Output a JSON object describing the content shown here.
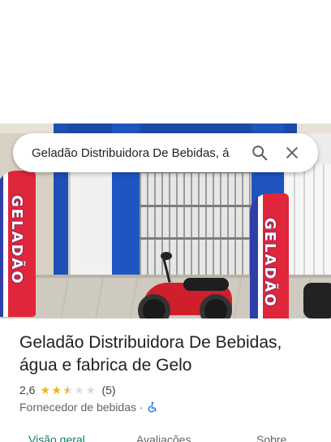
{
  "search": {
    "query": "Geladão Distribuidora De Bebidas, á",
    "search_icon": "search-icon",
    "close_icon": "close-icon"
  },
  "photo": {
    "banner_text": "GELADÃO"
  },
  "place": {
    "name": "Geladão Distribuidora De Bebidas, água e fabrica de Gelo",
    "rating_value": "2,6",
    "rating_stars": 2.6,
    "review_count": "(5)",
    "category": "Fornecedor de bebidas",
    "separator": "·",
    "accessibility_icon": "wheelchair-accessible-icon"
  },
  "tabs": [
    {
      "label": "Visão geral",
      "active": true
    },
    {
      "label": "Avaliações",
      "active": false
    },
    {
      "label": "Sobre",
      "active": false
    }
  ],
  "colors": {
    "accent_tab": "#0b7a6b",
    "star": "#f4b400",
    "accessibility_blue": "#1a73e8"
  }
}
